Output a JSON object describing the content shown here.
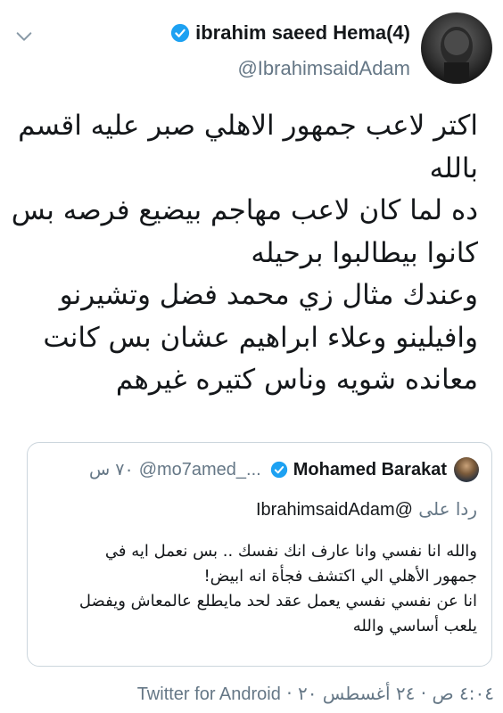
{
  "author": {
    "display_name": "ibrahim saeed Hema(4)",
    "handle": "@IbrahimsaidAdam",
    "verified": true
  },
  "tweet": {
    "lines": [
      "اكتر لاعب جمهور الاهلي صبر عليه اقسم",
      "بالله",
      "ده لما كان لاعب مهاجم  بيضيع فرصه بس",
      "كانوا بيطالبوا برحيله",
      "وعندك مثال زي محمد فضل وتشيرنو",
      "وافيلينو وعلاء ابراهيم عشان بس كانت",
      "معانده شويه  وناس كتيره غيرهم"
    ]
  },
  "quoted": {
    "author_name": "Mohamed Barakat",
    "handle": "@mo7amed_...",
    "time": "٧٠ س",
    "verified": true,
    "reply_label": "ردا على",
    "reply_mention": "@IbrahimsaidAdam",
    "lines": [
      "والله انا نفسي وانا عارف انك نفسك .. بس نعمل ايه في",
      "جمهور الأهلي الي اكتشف فجأة انه ابيض!",
      "انا عن نفسي نفسي يعمل عقد لحد مايطلع عالمعاش ويفضل",
      "يلعب أساسي والله"
    ]
  },
  "footer": {
    "time": "٤:٠٤ ص",
    "date": "٢٤ أغسطس ٢٠",
    "separator": "·",
    "source": "Twitter for Android"
  },
  "icons": {
    "chevron": "chevron-down-icon",
    "verified": "verified-badge-icon"
  },
  "colors": {
    "verified_blue": "#1da1f2",
    "secondary_text": "#657786",
    "border": "#ccd6dd"
  }
}
